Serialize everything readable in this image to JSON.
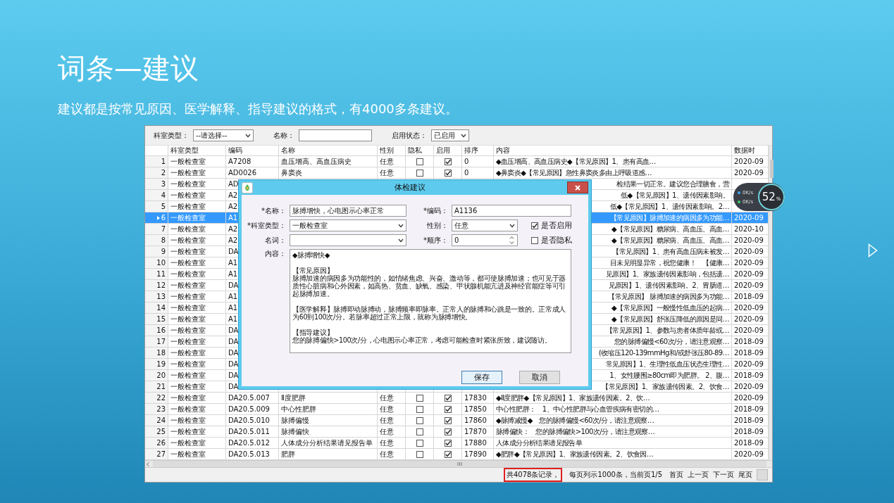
{
  "slide": {
    "title": "词条—建议",
    "subtitle": "建议都是按常见原因、医学解释、指导建议的格式，有4000多条建议。"
  },
  "window": {
    "filters": [
      {
        "kind": "select",
        "label": "科室类型：",
        "value": "--请选择--"
      },
      {
        "kind": "input",
        "label": "名称："
      },
      {
        "kind": "select",
        "label": "启用状态：",
        "value": "已启用"
      }
    ],
    "table": {
      "columns": [
        "科室类型",
        "编码",
        "名称",
        "性别",
        "隐私",
        "启用",
        "排序",
        "内容",
        "数据时"
      ],
      "rows": [
        {
          "kind": "full",
          "number": "1",
          "department": "一般检查室",
          "code": "A7208",
          "name": "血压增高、高血压病史",
          "gender": "任意",
          "private": false,
          "enabled": true,
          "order": "0",
          "content": "◆血压增高、高血压病史◆【常见原因】1、患有高血…",
          "date": "2020-09",
          "selected": false
        },
        {
          "kind": "full",
          "number": "2",
          "department": "一般检查室",
          "code": "AD0026",
          "name": "鼻窦炎",
          "gender": "任意",
          "private": false,
          "enabled": true,
          "order": "0",
          "content": "◆鼻窦炎◆【常见原因】急性鼻窦炎多由上呼吸道感…",
          "date": "2020-09",
          "selected": false
        },
        {
          "kind": "partial",
          "number": "3",
          "department": "一般检查室",
          "code": "AD",
          "content": "检结果一切正常。建议您合理膳食，营",
          "selected": false
        },
        {
          "kind": "partial",
          "number": "4",
          "department": "一般检查室",
          "code": "A2",
          "content": "低◆【常见原因】1、遗传因素影响。",
          "selected": false
        },
        {
          "kind": "partial",
          "number": "5",
          "department": "一般检查室",
          "code": "A2",
          "content": "低◆【常见原因】1、遗传因素影响。2…",
          "selected": false
        },
        {
          "kind": "partial",
          "number": "6",
          "department": "一般检查室",
          "code": "A1",
          "content": "【常见原因】脉搏加速的病因多为功能…",
          "date": "2020-09",
          "selected": true
        },
        {
          "kind": "partial",
          "number": "7",
          "department": "一般检查室",
          "code": "A2",
          "content": "◆【常见原因】糖尿病、高血压、高血…",
          "date": "2020-10",
          "selected": false
        },
        {
          "kind": "partial",
          "number": "8",
          "department": "一般检查室",
          "code": "A2",
          "content": "◆【常见原因】糖尿病、高血压、高血…",
          "date": "2020-09",
          "selected": false
        },
        {
          "kind": "partial",
          "number": "9",
          "department": "一般检查室",
          "code": "DA",
          "content": "【常见原因】1、患有高血压病未被发…",
          "date": "2020-09",
          "selected": false
        },
        {
          "kind": "partial",
          "number": "10",
          "department": "一般检查室",
          "code": "A1",
          "content": "目未见明显异常，祝您健康！　【健康…",
          "date": "2020-09",
          "selected": false
        },
        {
          "kind": "partial",
          "number": "11",
          "department": "一般检查室",
          "code": "A1",
          "content": "见原因】1、家族遗传因素影响，包括遗…",
          "date": "2020-09",
          "selected": false
        },
        {
          "kind": "partial",
          "number": "12",
          "department": "一般检查室",
          "code": "DA",
          "content": "见原因】1、遗传因素影响。2、胃肠道…",
          "date": "2020-09",
          "selected": false
        },
        {
          "kind": "partial",
          "number": "13",
          "department": "一般检查室",
          "code": "A1",
          "content": "【常见原因】 脉搏加速的病因多为功能…",
          "date": "2018-09",
          "selected": false
        },
        {
          "kind": "partial",
          "number": "14",
          "department": "一般检查室",
          "code": "A1",
          "content": "◆【常见原因】一般慢性低血压的起病…",
          "date": "2020-09",
          "selected": false
        },
        {
          "kind": "partial",
          "number": "15",
          "department": "一般检查室",
          "code": "A1",
          "content": "◆【常见原因】舒张压降低的原因是同…",
          "date": "2020-09",
          "selected": false
        },
        {
          "kind": "partial",
          "number": "16",
          "department": "一般检查室",
          "code": "DA",
          "content": "【常见原因】1、参数与患者体质年龄或…",
          "date": "2020-09",
          "selected": false
        },
        {
          "kind": "partial",
          "number": "17",
          "department": "一般检查室",
          "code": "DA",
          "content": "您的脉搏偏慢<60次/分，请注意观察…",
          "date": "2018-09",
          "selected": false
        },
        {
          "kind": "partial",
          "number": "18",
          "department": "一般检查室",
          "code": "DA",
          "content": "(收缩压120-139mmHg和/或舒张压80-89…",
          "date": "2018-09",
          "selected": false
        },
        {
          "kind": "partial",
          "number": "19",
          "department": "一般检查室",
          "code": "DA",
          "content": "常见原因】1、生理性低血压状态生理性…",
          "date": "2020-09",
          "selected": false
        },
        {
          "kind": "partial",
          "number": "20",
          "department": "一般检查室",
          "code": "DA",
          "content": "1、女性腰围≥80cm即为肥胖。 2、腹…",
          "date": "2018-09",
          "selected": false
        },
        {
          "kind": "partial",
          "number": "21",
          "department": "一般检查室",
          "code": "DA",
          "content": "【常见原因】1、家族遗传因素。2、饮食…",
          "date": "2020-09",
          "selected": false
        },
        {
          "kind": "full",
          "number": "22",
          "department": "一般检查室",
          "code": "DA20.5.007",
          "name": "Ⅱ度肥胖",
          "gender": "任意",
          "private": false,
          "enabled": true,
          "order": "17830",
          "content": "◆Ⅱ度肥胖◆【常见原因】1、家族遗传因素。2、饮…",
          "date": "2020-09",
          "selected": false
        },
        {
          "kind": "full",
          "number": "23",
          "department": "一般检查室",
          "code": "DA20.5.009",
          "name": "中心性肥胖",
          "gender": "任意",
          "private": false,
          "enabled": true,
          "order": "17850",
          "content": "中心性肥胖：　1、中心性肥胖与心血管疾病有密切的…",
          "date": "2018-09",
          "selected": false
        },
        {
          "kind": "full",
          "number": "24",
          "department": "一般检查室",
          "code": "DA20.5.010",
          "name": "脉搏偏慢",
          "gender": "任意",
          "private": false,
          "enabled": true,
          "order": "17860",
          "content": "◆脉搏减慢◆　您的脉搏偏慢<60次/分，请注意观察…",
          "date": "2018-09",
          "selected": false
        },
        {
          "kind": "full",
          "number": "25",
          "department": "一般检查室",
          "code": "DA20.5.011",
          "name": "脉搏偏快",
          "gender": "任意",
          "private": false,
          "enabled": true,
          "order": "17870",
          "content": "脉搏偏快：　您的脉搏偏快>100次/分，请注意观察…",
          "date": "2018-09",
          "selected": false
        },
        {
          "kind": "full",
          "number": "26",
          "department": "一般检查室",
          "code": "DA20.5.012",
          "name": "人体成分分析结果请见报告单",
          "gender": "任意",
          "private": false,
          "enabled": true,
          "order": "17880",
          "content": "人体成分分析结果请见报告单",
          "date": "2018-09",
          "selected": false
        },
        {
          "kind": "full",
          "number": "27",
          "department": "一般检查室",
          "code": "DA20.5.013",
          "name": "肥胖",
          "gender": "任意",
          "private": false,
          "enabled": true,
          "order": "17890",
          "content": "◆肥胖◆【常见原因】1、家族遗传因素。2、饮食因…",
          "date": "2020-09",
          "selected": false
        }
      ]
    },
    "status_bar": {
      "parts": [
        {
          "text": "共4078条记录，",
          "highlighted": true
        },
        {
          "text": "每页列示1000条，当前页1/5",
          "highlighted": false
        }
      ],
      "links": [
        "首页",
        "上一页",
        "下一页",
        "尾页"
      ]
    },
    "dialog": {
      "title": "体检建议",
      "name": {
        "label": "*名称：",
        "value": "脉搏增快，心电图示心率正常"
      },
      "code": {
        "label": "*编码：",
        "value": "A1136"
      },
      "department": {
        "label": "*科室类型：",
        "value": "一般检查室"
      },
      "gender": {
        "label": "性别：",
        "value": "任意"
      },
      "term": {
        "label": "名词："
      },
      "order": {
        "label": "*顺序：",
        "value": "0"
      },
      "content": {
        "label": "内容：",
        "paragraphs": [
          [
            "◆脉搏增快◆"
          ],
          [
            "【常见原因】",
            "脉搏加速的病因多为功能性的，如情绪焦虑、兴奋、激动等，都可使脉搏加速；也可见于器质性心脏病和心外因素，如高热、贫血、缺氧、感染、甲状腺机能亢进及神经官能症等可引起脉搏加速。"
          ],
          [
            "【医学解释】脉搏即动脉搏动，脉搏频率即脉率。正常人的脉搏和心跳是一致的。正常成人为60到100次/分。若脉率超过正常上限，就称为脉搏增快。"
          ],
          [
            "【指导建议】",
            "您的脉搏偏快>100次/分，心电图示心率正常，考虑可能检查时紧张所致，建议随访。"
          ]
        ]
      },
      "enabled": {
        "label": "是否启用",
        "checked": true
      },
      "private": {
        "label": "是否隐私",
        "checked": false
      },
      "buttons": [
        {
          "label": "保存",
          "default": true
        },
        {
          "label": "取消",
          "default": false
        }
      ]
    },
    "net_monitor": {
      "percent": "52",
      "unit": "%",
      "rates": [
        {
          "text": "0K/s",
          "color": "#3fa9f5"
        },
        {
          "text": "0K/s",
          "color": "#3ecf6e"
        }
      ]
    }
  }
}
